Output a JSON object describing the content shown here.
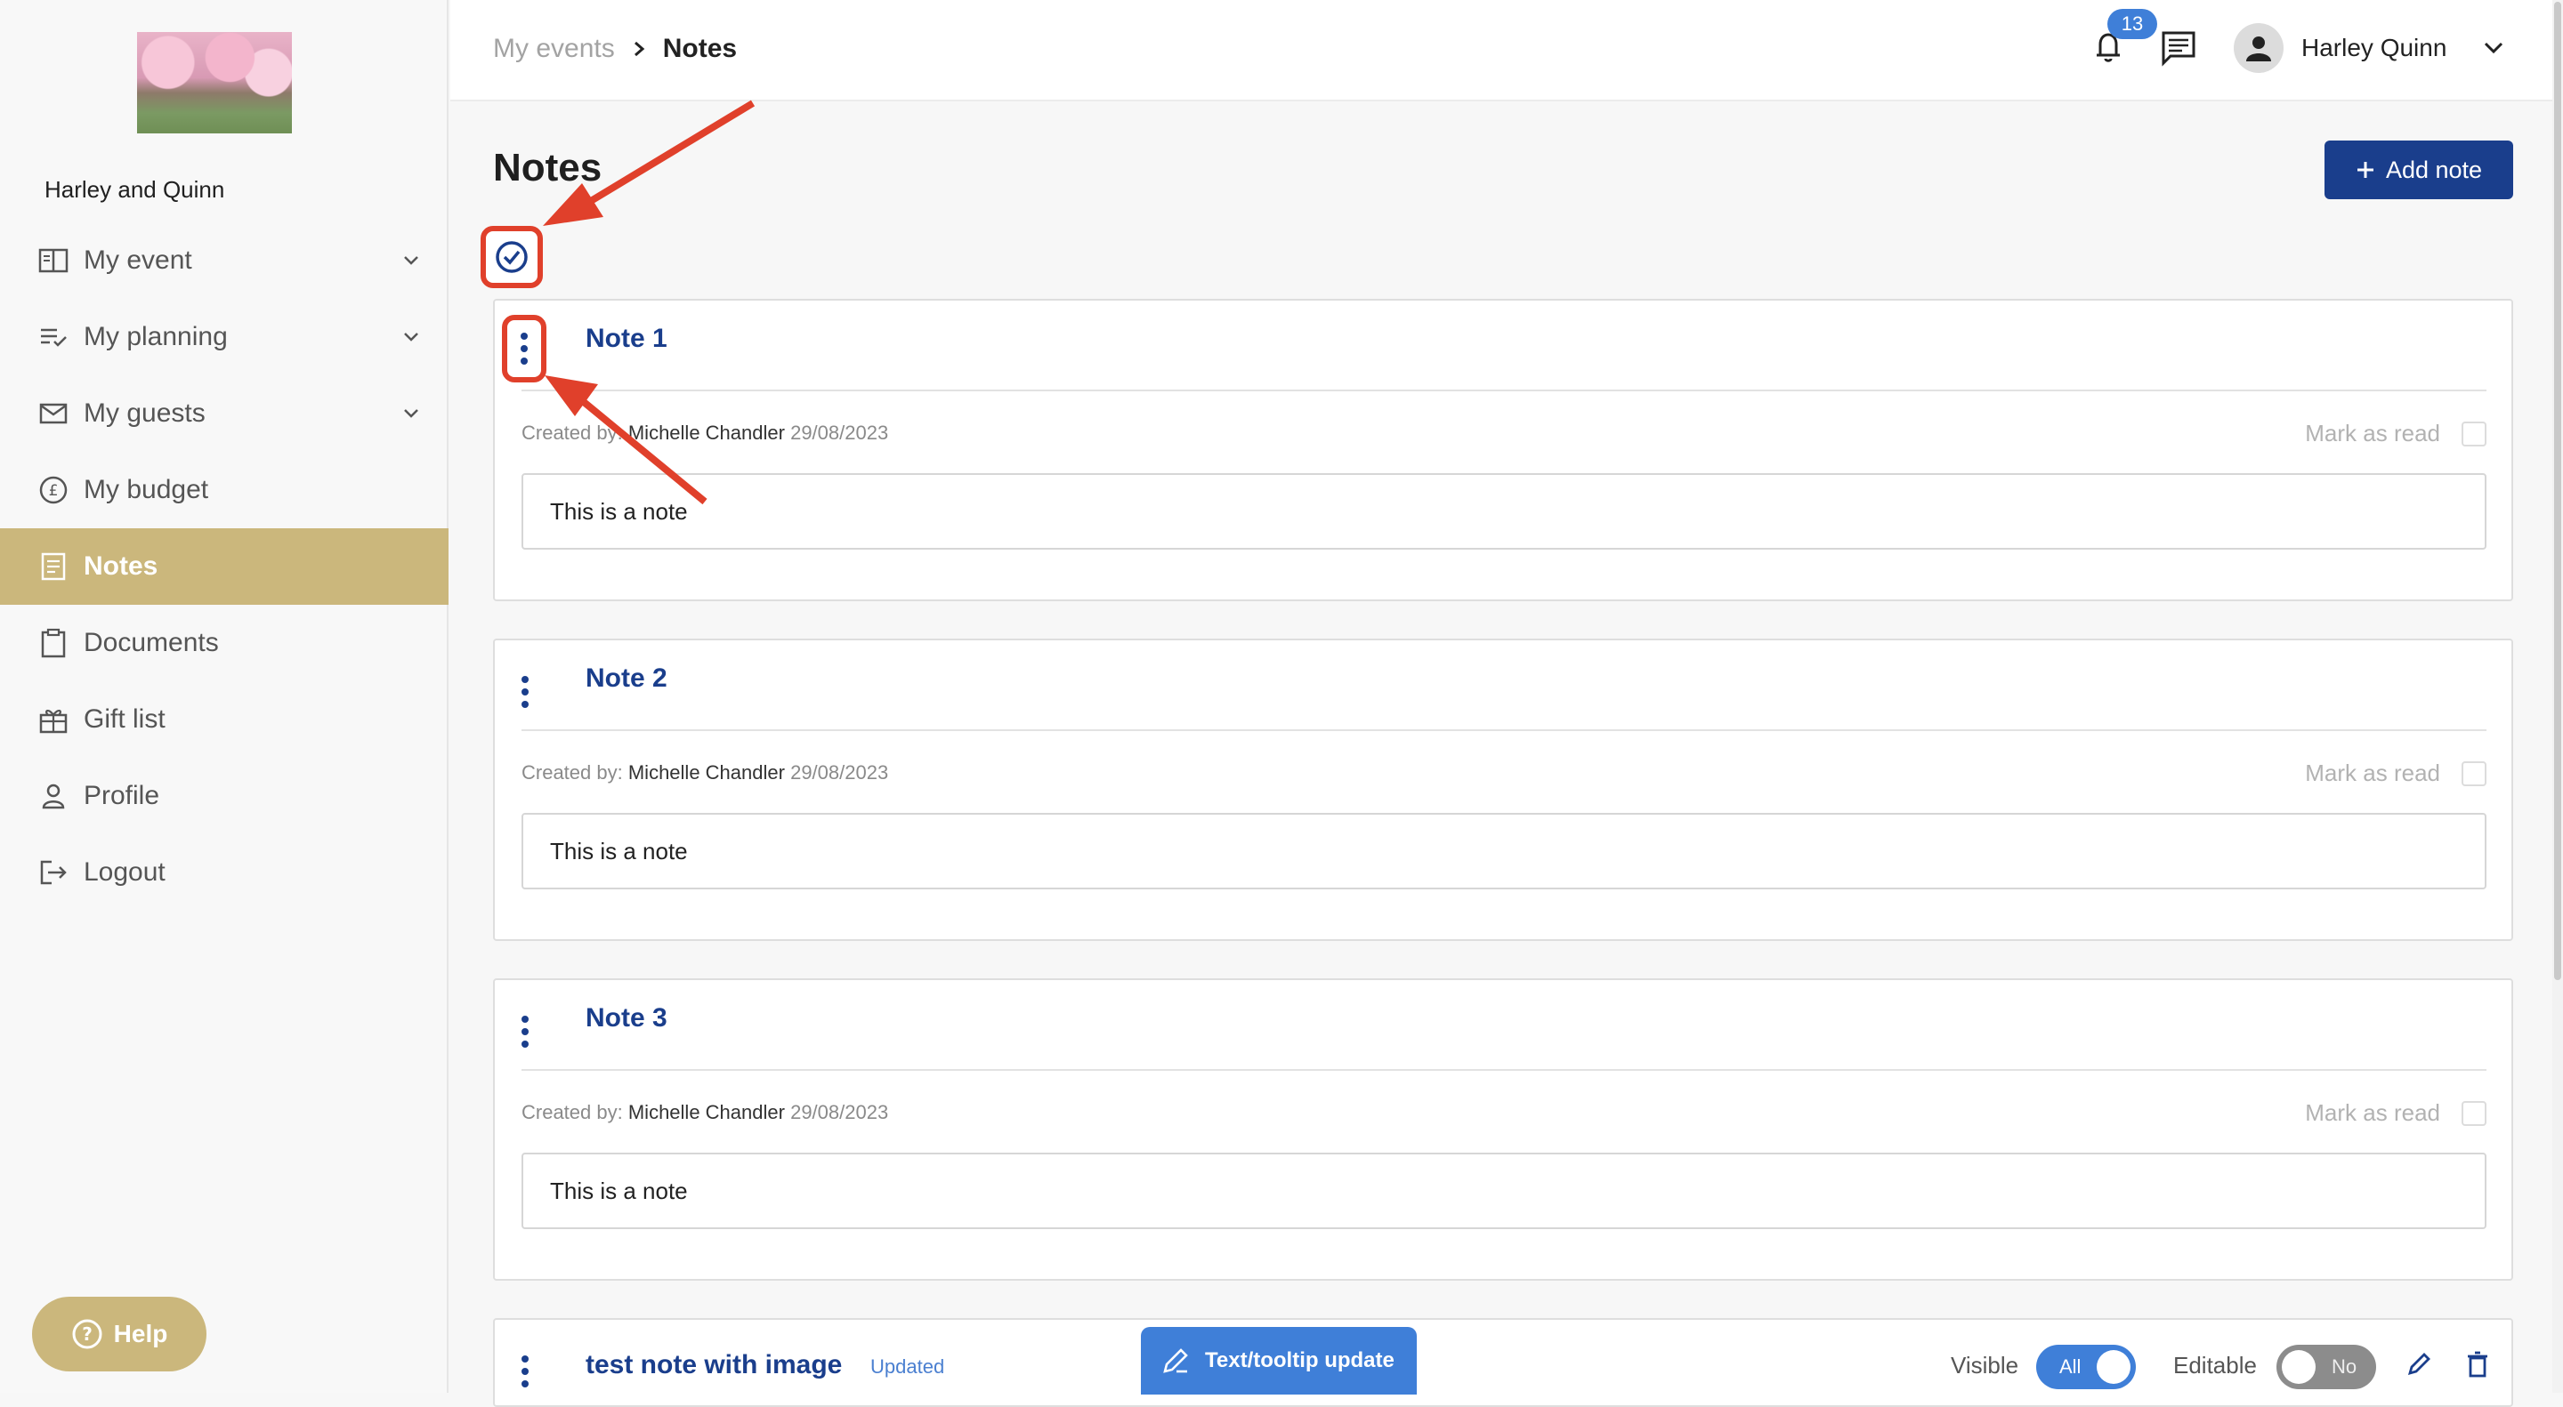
{
  "sidebar": {
    "event_name": "Harley and Quinn",
    "items": [
      {
        "label": "My event",
        "icon": "book-icon",
        "has_chevron": true
      },
      {
        "label": "My planning",
        "icon": "checklist-icon",
        "has_chevron": true
      },
      {
        "label": "My guests",
        "icon": "mail-icon",
        "has_chevron": true
      },
      {
        "label": "My budget",
        "icon": "pound-icon",
        "has_chevron": false
      },
      {
        "label": "Notes",
        "icon": "note-icon",
        "has_chevron": false,
        "active": true
      },
      {
        "label": "Documents",
        "icon": "clipboard-icon",
        "has_chevron": false
      },
      {
        "label": "Gift list",
        "icon": "gift-icon",
        "has_chevron": false
      },
      {
        "label": "Profile",
        "icon": "person-icon",
        "has_chevron": false
      },
      {
        "label": "Logout",
        "icon": "logout-icon",
        "has_chevron": false
      }
    ],
    "help_label": "Help"
  },
  "header": {
    "breadcrumb": [
      "My events",
      "Notes"
    ],
    "notification_count": "13",
    "user_name": "Harley Quinn"
  },
  "main": {
    "title": "Notes",
    "add_button_label": "Add note",
    "notes": [
      {
        "title": "Note 1",
        "created_prefix": "Created by:",
        "author": "Michelle Chandler",
        "date": "29/08/2023",
        "mark_label": "Mark as read",
        "body": "This is a note"
      },
      {
        "title": "Note 2",
        "created_prefix": "Created by:",
        "author": "Michelle Chandler",
        "date": "29/08/2023",
        "mark_label": "Mark as read",
        "body": "This is a note"
      },
      {
        "title": "Note 3",
        "created_prefix": "Created by:",
        "author": "Michelle Chandler",
        "date": "29/08/2023",
        "mark_label": "Mark as read",
        "body": "This is a note"
      }
    ],
    "partial_note": {
      "title": "test note with image",
      "status": "Updated",
      "visible_label": "Visible",
      "visible_value": "All",
      "editable_label": "Editable",
      "editable_value": "No"
    },
    "tooltip_update_label": "Text/tooltip update"
  },
  "colors": {
    "accent_gold": "#cbb77c",
    "primary_navy": "#1a3e8c",
    "link_blue": "#3f7fd8",
    "annotation_red": "#e0402b"
  }
}
